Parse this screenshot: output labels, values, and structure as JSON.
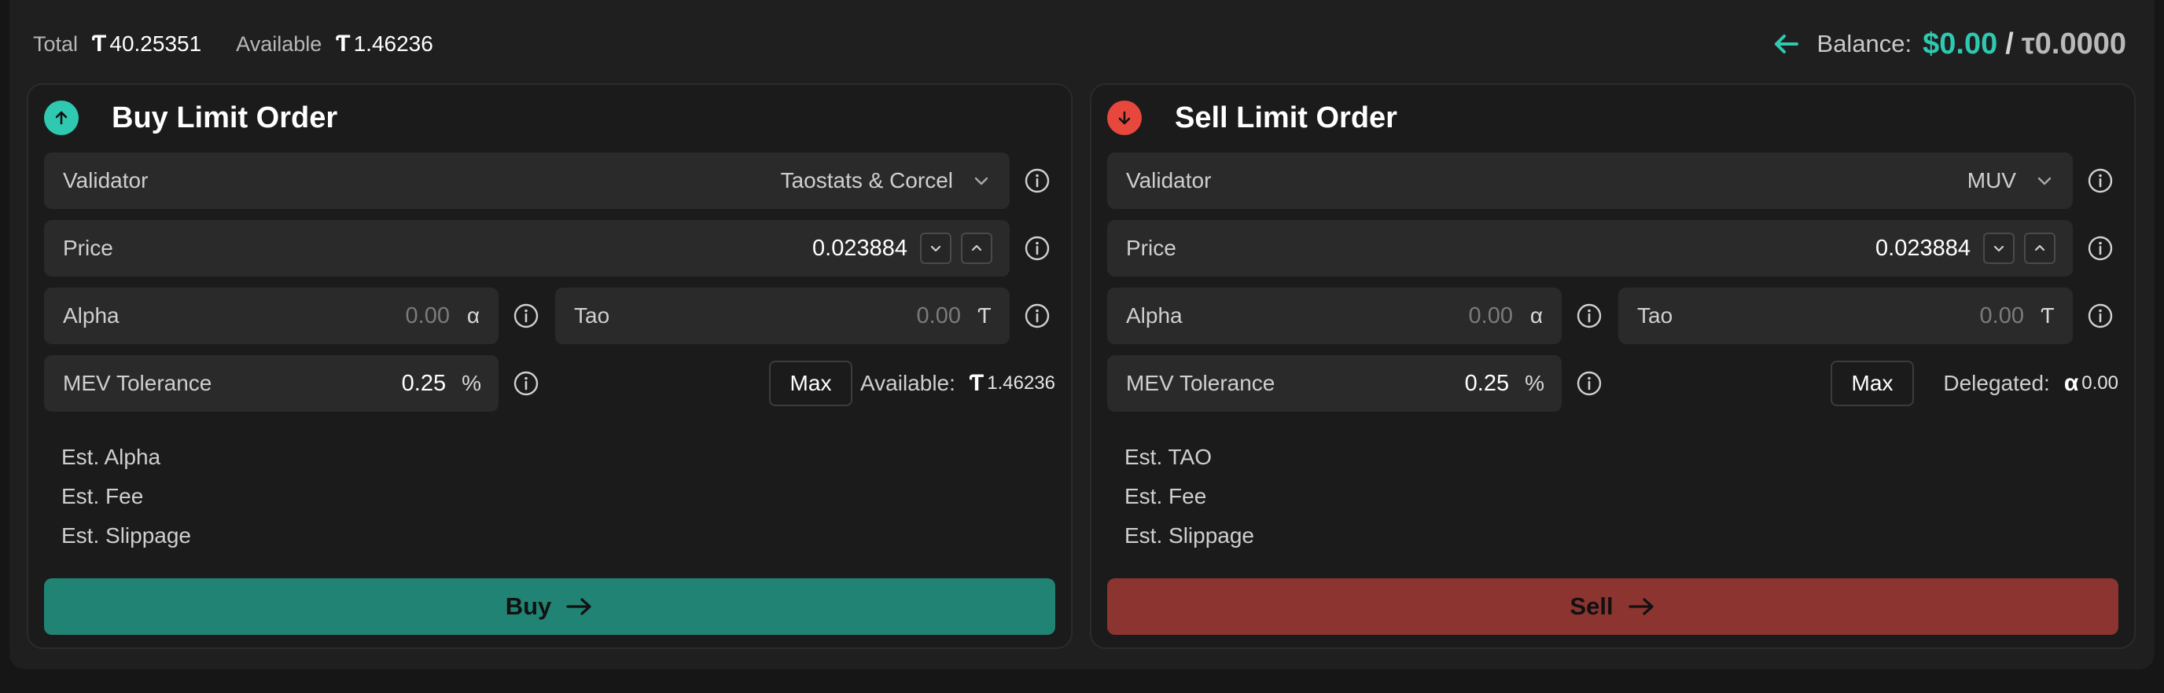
{
  "header": {
    "total_label": "Total",
    "total_symbol": "Ƭ",
    "total_value": "40.25351",
    "available_label": "Available",
    "available_symbol": "Ƭ",
    "available_value": "1.46236",
    "balance_label": "Balance:",
    "balance_usd": "$0.00",
    "balance_sep": "/",
    "balance_tao": "τ0.0000",
    "back_icon": "arrow-left-icon"
  },
  "colors": {
    "accent_teal": "#2ec9b0",
    "buy_button": "#218373",
    "sell_button": "#8b3430",
    "sell_badge": "#e8473d"
  },
  "buy": {
    "title": "Buy Limit Order",
    "validator_label": "Validator",
    "validator_value": "Taostats & Corcel",
    "price_label": "Price",
    "price_value": "0.023884",
    "alpha_label": "Alpha",
    "alpha_value": "0.00",
    "alpha_unit": "α",
    "tao_label": "Tao",
    "tao_value": "0.00",
    "tao_unit": "Ƭ",
    "mev_label": "MEV Tolerance",
    "mev_value": "0.25",
    "mev_unit": "%",
    "max_label": "Max",
    "avail_label": "Available:",
    "avail_symbol": "Ƭ",
    "avail_value": "1.46236",
    "est1": "Est. Alpha",
    "est2": "Est. Fee",
    "est3": "Est. Slippage",
    "action_label": "Buy"
  },
  "sell": {
    "title": "Sell Limit Order",
    "validator_label": "Validator",
    "validator_value": "MUV",
    "price_label": "Price",
    "price_value": "0.023884",
    "alpha_label": "Alpha",
    "alpha_value": "0.00",
    "alpha_unit": "α",
    "tao_label": "Tao",
    "tao_value": "0.00",
    "tao_unit": "Ƭ",
    "mev_label": "MEV Tolerance",
    "mev_value": "0.25",
    "mev_unit": "%",
    "max_label": "Max",
    "avail_label": "Delegated:",
    "avail_symbol": "α",
    "avail_value": "0.00",
    "est1": "Est. TAO",
    "est2": "Est. Fee",
    "est3": "Est. Slippage",
    "action_label": "Sell"
  }
}
